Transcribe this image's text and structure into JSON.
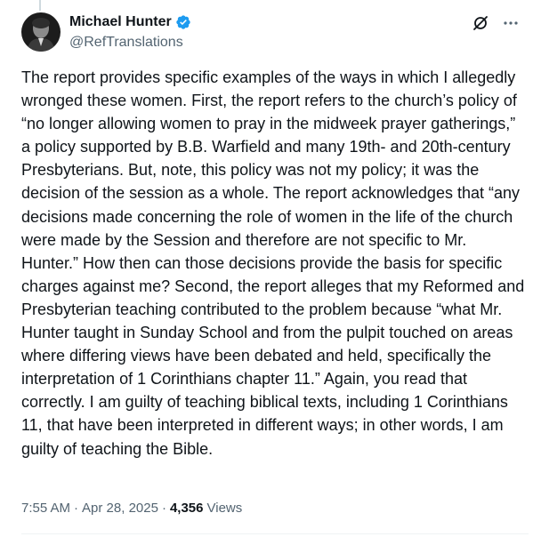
{
  "author": {
    "display_name": "Michael Hunter",
    "handle": "@RefTranslations",
    "verified": true
  },
  "icons": {
    "avatar": "avatar-photo",
    "verified": "verified-badge-icon",
    "grok": "grok-icon",
    "more": "more-icon"
  },
  "colors": {
    "verified_blue": "#1d9bf0",
    "text_primary": "#0f1419",
    "text_secondary": "#536471"
  },
  "post": {
    "text": "The report provides specific examples of the ways in which I allegedly wronged these women. First, the report refers to the church’s policy of “no longer allowing women to pray in the midweek prayer gatherings,” a policy supported by B.B. Warfield and many 19th- and 20th-century Presbyterians. But, note, this policy was not my policy; it was the decision of the session as a whole. The report acknowledges that “any decisions made concerning the role of women in the life of the church were made by the Session and therefore are not specific to Mr. Hunter.” How then can those decisions provide the basis for specific charges against me? Second, the report alleges that my Reformed and Presbyterian teaching contributed to the problem because “what Mr. Hunter taught in Sunday School and from the pulpit touched on areas where differing views have been debated and held, specifically the interpretation of 1 Corinthians chapter 11.” Again, you read that correctly. I am guilty of teaching biblical texts, including 1 Corinthians 11, that have been interpreted in different ways; in other words, I am guilty of teaching the Bible."
  },
  "meta": {
    "time": "7:55 AM",
    "separator": "·",
    "date": "Apr 28, 2025",
    "views_count": "4,356",
    "views_label": "Views"
  }
}
